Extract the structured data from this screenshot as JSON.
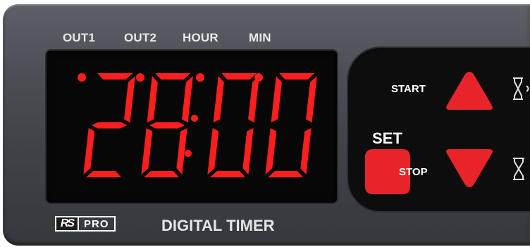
{
  "labels": {
    "out1": "OUT1",
    "out2": "OUT2",
    "hour": "HOUR",
    "min": "MIN"
  },
  "display": {
    "value": "28:00",
    "color": "#ff1e1e"
  },
  "buttons": {
    "start_label": "START",
    "stop_label": "STOP",
    "set_label": "SET"
  },
  "brand": {
    "logo_rs": "RS",
    "logo_pro": "PRO",
    "product_name": "DIGITAL TIMER"
  },
  "icons": {
    "start_side": "hourglass-run-icon",
    "stop_side": "hourglass-icon"
  },
  "colors": {
    "panel": "#474b51",
    "accent": "#e8242a",
    "display_bg": "#070707"
  }
}
